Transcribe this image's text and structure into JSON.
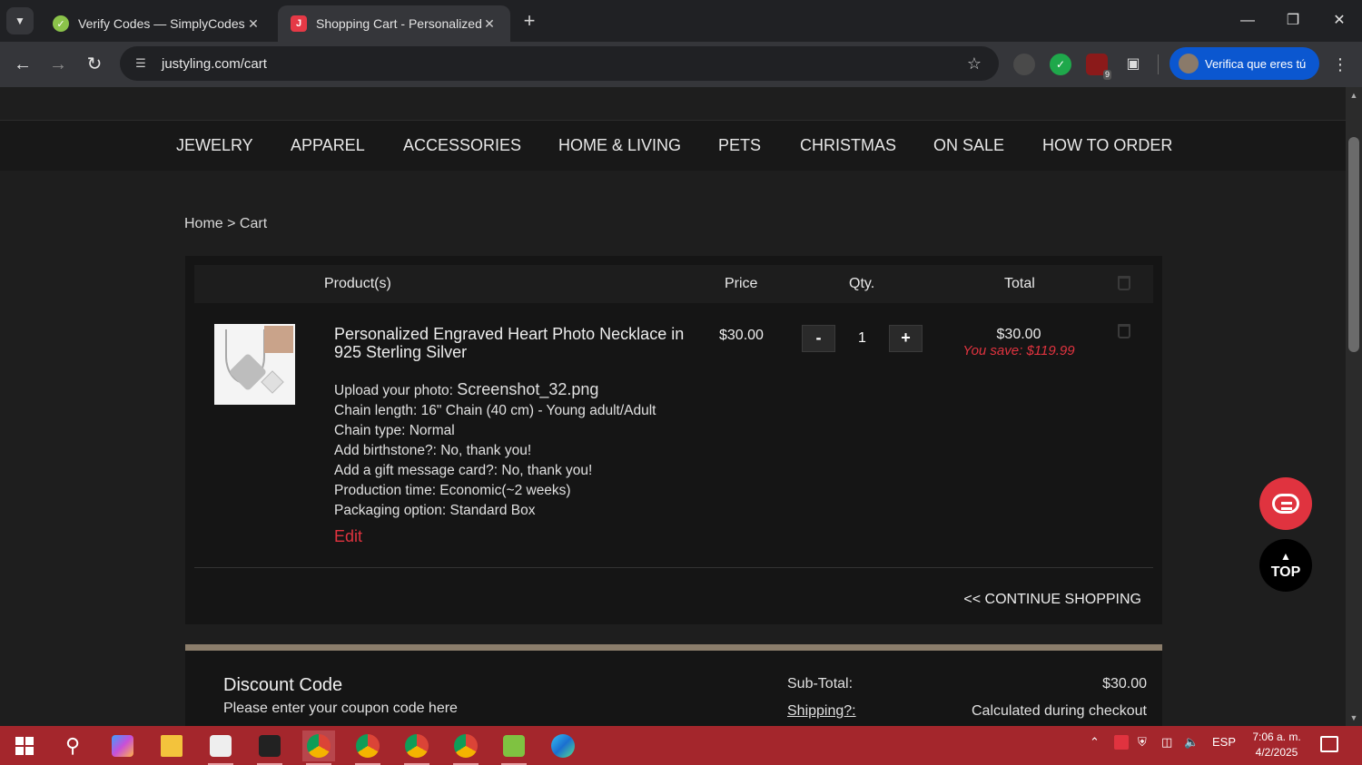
{
  "browser": {
    "tabs": [
      {
        "title": "Verify Codes — SimplyCodes",
        "favicon": "simplycodes-icon",
        "active": false
      },
      {
        "title": "Shopping Cart - Personalized G",
        "favicon": "justyling-icon",
        "active": true
      }
    ],
    "url": "justyling.com/cart",
    "profile_label": "Verifica que eres tú",
    "extension_badge": "9"
  },
  "site": {
    "nav": [
      "JEWELRY",
      "APPAREL",
      "ACCESSORIES",
      "HOME & LIVING",
      "PETS",
      "CHRISTMAS",
      "ON SALE",
      "HOW TO ORDER"
    ],
    "breadcrumb": "Home > Cart"
  },
  "cart": {
    "headers": {
      "product": "Product(s)",
      "price": "Price",
      "qty": "Qty.",
      "total": "Total"
    },
    "item": {
      "name": "Personalized Engraved Heart Photo Necklace in 925 Sterling Silver",
      "price": "$30.00",
      "qty": "1",
      "qty_minus": "-",
      "qty_plus": "+",
      "total": "$30.00",
      "you_save": "You save: $119.99",
      "upload_label": "Upload your photo: ",
      "upload_value": "Screenshot_32.png",
      "options": [
        "Chain length: 16\" Chain (40 cm) - Young adult/Adult",
        "Chain type: Normal",
        "Add birthstone?: No, thank you!",
        "Add a gift message card?: No, thank you!",
        "Production time: Economic(~2 weeks)",
        "Packaging option: Standard Box"
      ],
      "edit_label": "Edit"
    },
    "continue_label": "<< CONTINUE SHOPPING"
  },
  "summary": {
    "discount_title": "Discount Code",
    "discount_sub": "Please enter your coupon code here",
    "subtotal_label": "Sub-Total:",
    "subtotal_value": "$30.00",
    "shipping_label": "Shipping?:",
    "shipping_value": "Calculated during checkout"
  },
  "floating": {
    "top_label": "TOP"
  },
  "taskbar": {
    "language": "ESP",
    "time": "7:06 a. m.",
    "date": "4/2/2025"
  },
  "colors": {
    "accent_red": "#e0333f",
    "taskbar": "#a4262c",
    "profile_blue": "#0b57d0"
  }
}
